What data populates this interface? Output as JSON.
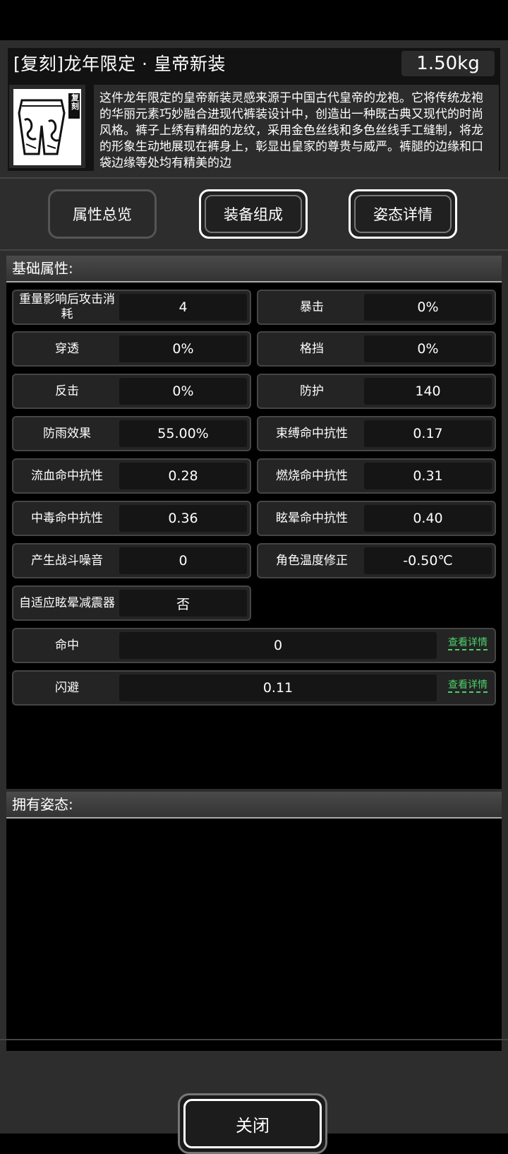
{
  "header": {
    "title": "[复刻]龙年限定 · 皇帝新装",
    "weight": "1.50kg",
    "badge": "复刻",
    "description": "这件龙年限定的皇帝新装灵感来源于中国古代皇帝的龙袍。它将传统龙袍的华丽元素巧妙融合进现代裤装设计中，创造出一种既古典又现代的时尚风格。裤子上绣有精细的龙纹，采用金色丝线和多色丝线手工缝制，将龙的形象生动地展现在裤身上，彰显出皇家的尊贵与威严。裤腿的边缘和口袋边缘等处均有精美的边"
  },
  "tabs": [
    {
      "label": "属性总览"
    },
    {
      "label": "装备组成"
    },
    {
      "label": "姿态详情"
    }
  ],
  "base": {
    "title": "基础属性:",
    "stats": [
      {
        "label": "重量影响后攻击消耗",
        "value": "4"
      },
      {
        "label": "暴击",
        "value": "0%"
      },
      {
        "label": "穿透",
        "value": "0%"
      },
      {
        "label": "格挡",
        "value": "0%"
      },
      {
        "label": "反击",
        "value": "0%"
      },
      {
        "label": "防护",
        "value": "140"
      },
      {
        "label": "防雨效果",
        "value": "55.00%"
      },
      {
        "label": "束缚命中抗性",
        "value": "0.17"
      },
      {
        "label": "流血命中抗性",
        "value": "0.28"
      },
      {
        "label": "燃烧命中抗性",
        "value": "0.31"
      },
      {
        "label": "中毒命中抗性",
        "value": "0.36"
      },
      {
        "label": "眩晕命中抗性",
        "value": "0.40"
      },
      {
        "label": "产生战斗噪音",
        "value": "0"
      },
      {
        "label": "角色温度修正",
        "value": "-0.50℃"
      },
      {
        "label": "自适应眩晕减震器",
        "value": "否"
      }
    ],
    "wide_stats": [
      {
        "label": "命中",
        "value": "0",
        "link": "查看详情"
      },
      {
        "label": "闪避",
        "value": "0.11",
        "link": "查看详情"
      }
    ]
  },
  "posture": {
    "title": "拥有姿态:"
  },
  "close_label": "关闭",
  "colors": {
    "link": "#4bd06a",
    "background": "#2d2d2d"
  }
}
